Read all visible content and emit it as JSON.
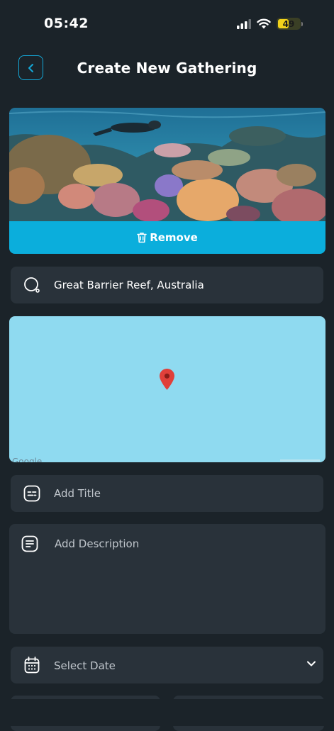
{
  "status": {
    "time": "05:42",
    "battery": "49",
    "battery_level": 0.49
  },
  "header": {
    "title": "Create New Gathering"
  },
  "cover": {
    "remove_label": "Remove"
  },
  "location": {
    "value": "Great Barrier Reef, Australia"
  },
  "map": {
    "logo": "Google"
  },
  "title_field": {
    "placeholder": "Add Title"
  },
  "description_field": {
    "placeholder": "Add Description"
  },
  "date_field": {
    "placeholder": "Select Date"
  },
  "colors": {
    "accent": "#0baedc",
    "background": "#1b2329",
    "field": "#29323a",
    "map_water": "#8fdaf0",
    "pin": "#e0403a"
  },
  "icons": [
    "back-chevron-icon",
    "trash-icon",
    "search-icon",
    "title-icon",
    "description-icon",
    "calendar-icon",
    "chevron-down-icon",
    "map-pin-icon",
    "signal-icon",
    "wifi-icon",
    "battery-icon"
  ]
}
